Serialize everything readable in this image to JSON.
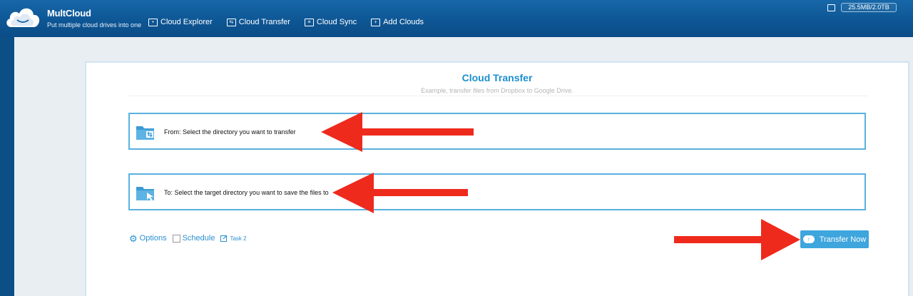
{
  "brand": {
    "name": "MultCloud",
    "tagline": "Put multiple cloud drives into one"
  },
  "nav": {
    "items": [
      {
        "label": "Cloud Explorer",
        "icon": "explorer-icon"
      },
      {
        "label": "Cloud Transfer",
        "icon": "transfer-icon"
      },
      {
        "label": "Cloud Sync",
        "icon": "sync-icon"
      },
      {
        "label": "Add Clouds",
        "icon": "add-icon"
      }
    ]
  },
  "storage": {
    "usage": "25.5MB/2.0TB"
  },
  "transfer": {
    "title": "Cloud Transfer",
    "subtitle": "Example, transfer files from Dropbox to Google Drive.",
    "from_label": "From: Select the directory you want to transfer",
    "to_label": "To: Select the target directory you want to save the files to",
    "options_label": "Options",
    "schedule_label": "Schedule",
    "task_label": "Task 2",
    "transfer_button": "Transfer Now"
  },
  "colors": {
    "header": "#0d5593",
    "accent": "#1b8fd0",
    "button": "#3ea5dd",
    "annotation_arrow": "#ee2a1c"
  }
}
